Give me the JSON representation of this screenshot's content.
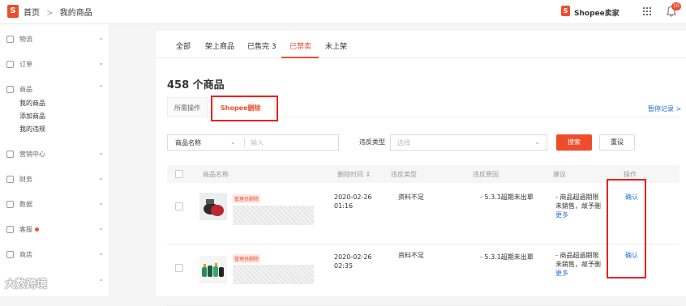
{
  "header": {
    "logo": "S",
    "breadcrumb": [
      "首页",
      "我的商品"
    ],
    "breadcrumb_sep": ">",
    "seller_logo": "S",
    "seller_center": "Shopee卖家",
    "notification_count": "10"
  },
  "sidebar": {
    "items": [
      {
        "label": "物流"
      },
      {
        "label": "订单"
      },
      {
        "label": "商品",
        "expanded": true
      },
      {
        "label": "营销中心"
      },
      {
        "label": "财务"
      },
      {
        "label": "数据"
      },
      {
        "label": "客服"
      },
      {
        "label": "商店"
      }
    ],
    "sub_items": [
      "我的商品",
      "添加商品",
      "我的违规"
    ],
    "chev_down": "⌄",
    "chev_up": "⌃"
  },
  "tabs": [
    {
      "label": "全部"
    },
    {
      "label": "架上商品"
    },
    {
      "label": "已售完 3"
    },
    {
      "label": "已禁卖",
      "active": true
    },
    {
      "label": "未上架"
    }
  ],
  "count_title": "458 个商品",
  "subtabs": [
    {
      "label": "所需操作"
    },
    {
      "label": "Shopee删除",
      "active": true
    }
  ],
  "history_link": "暂停记录 >",
  "filters": {
    "field_select": "商品名称",
    "field_chev": "⌄",
    "keyword_placeholder": "输入",
    "violation_label": "违反类型",
    "violation_placeholder": "选择",
    "violation_chev": "⌄",
    "search_button": "搜索",
    "reset_button": "重设"
  },
  "table": {
    "headers": [
      "商品名称",
      "删除时间 ⇕",
      "违反类型",
      "违反原因",
      "建议",
      "操作"
    ],
    "rows": [
      {
        "tag": "管理员删除",
        "date": "2020-02-26",
        "time": "01:16",
        "violation_type": "资料不足",
        "reason": "- 5.3.1超期未出單",
        "suggestion_1": "- 商品超過期限",
        "suggestion_2": "未銷售，故予刪",
        "more": "更多",
        "action": "确认"
      },
      {
        "tag": "管理员删除",
        "date": "2020-02-26",
        "time": "02:35",
        "violation_type": "资料不足",
        "reason": "- 5.3.1超期未出單",
        "suggestion_1": "- 商品超過期限",
        "suggestion_2": "未銷售，故予刪",
        "more": "更多",
        "action": "确认"
      }
    ]
  },
  "watermark": "大数跨境",
  "colors": {
    "accent": "#ee4d2d",
    "link": "#2673dd",
    "highlight": "#e52222"
  }
}
